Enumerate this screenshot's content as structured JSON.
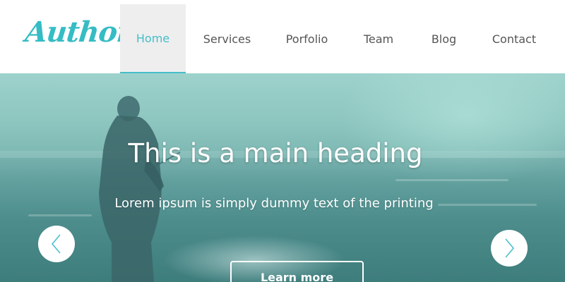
{
  "brand": {
    "logo_text": "Author",
    "accent_color": "#45bec8"
  },
  "nav": {
    "items": [
      {
        "label": "Home",
        "active": true
      },
      {
        "label": "Services",
        "active": false
      },
      {
        "label": "Porfolio",
        "active": false
      },
      {
        "label": "Team",
        "active": false
      },
      {
        "label": "Blog",
        "active": false
      },
      {
        "label": "Contact",
        "active": false
      }
    ]
  },
  "hero": {
    "heading": "This is a main heading",
    "subheading": "Lorem ipsum is simply dummy text of the printing",
    "cta_label": "Learn more",
    "prev_icon": "chevron-left-icon",
    "next_icon": "chevron-right-icon"
  }
}
